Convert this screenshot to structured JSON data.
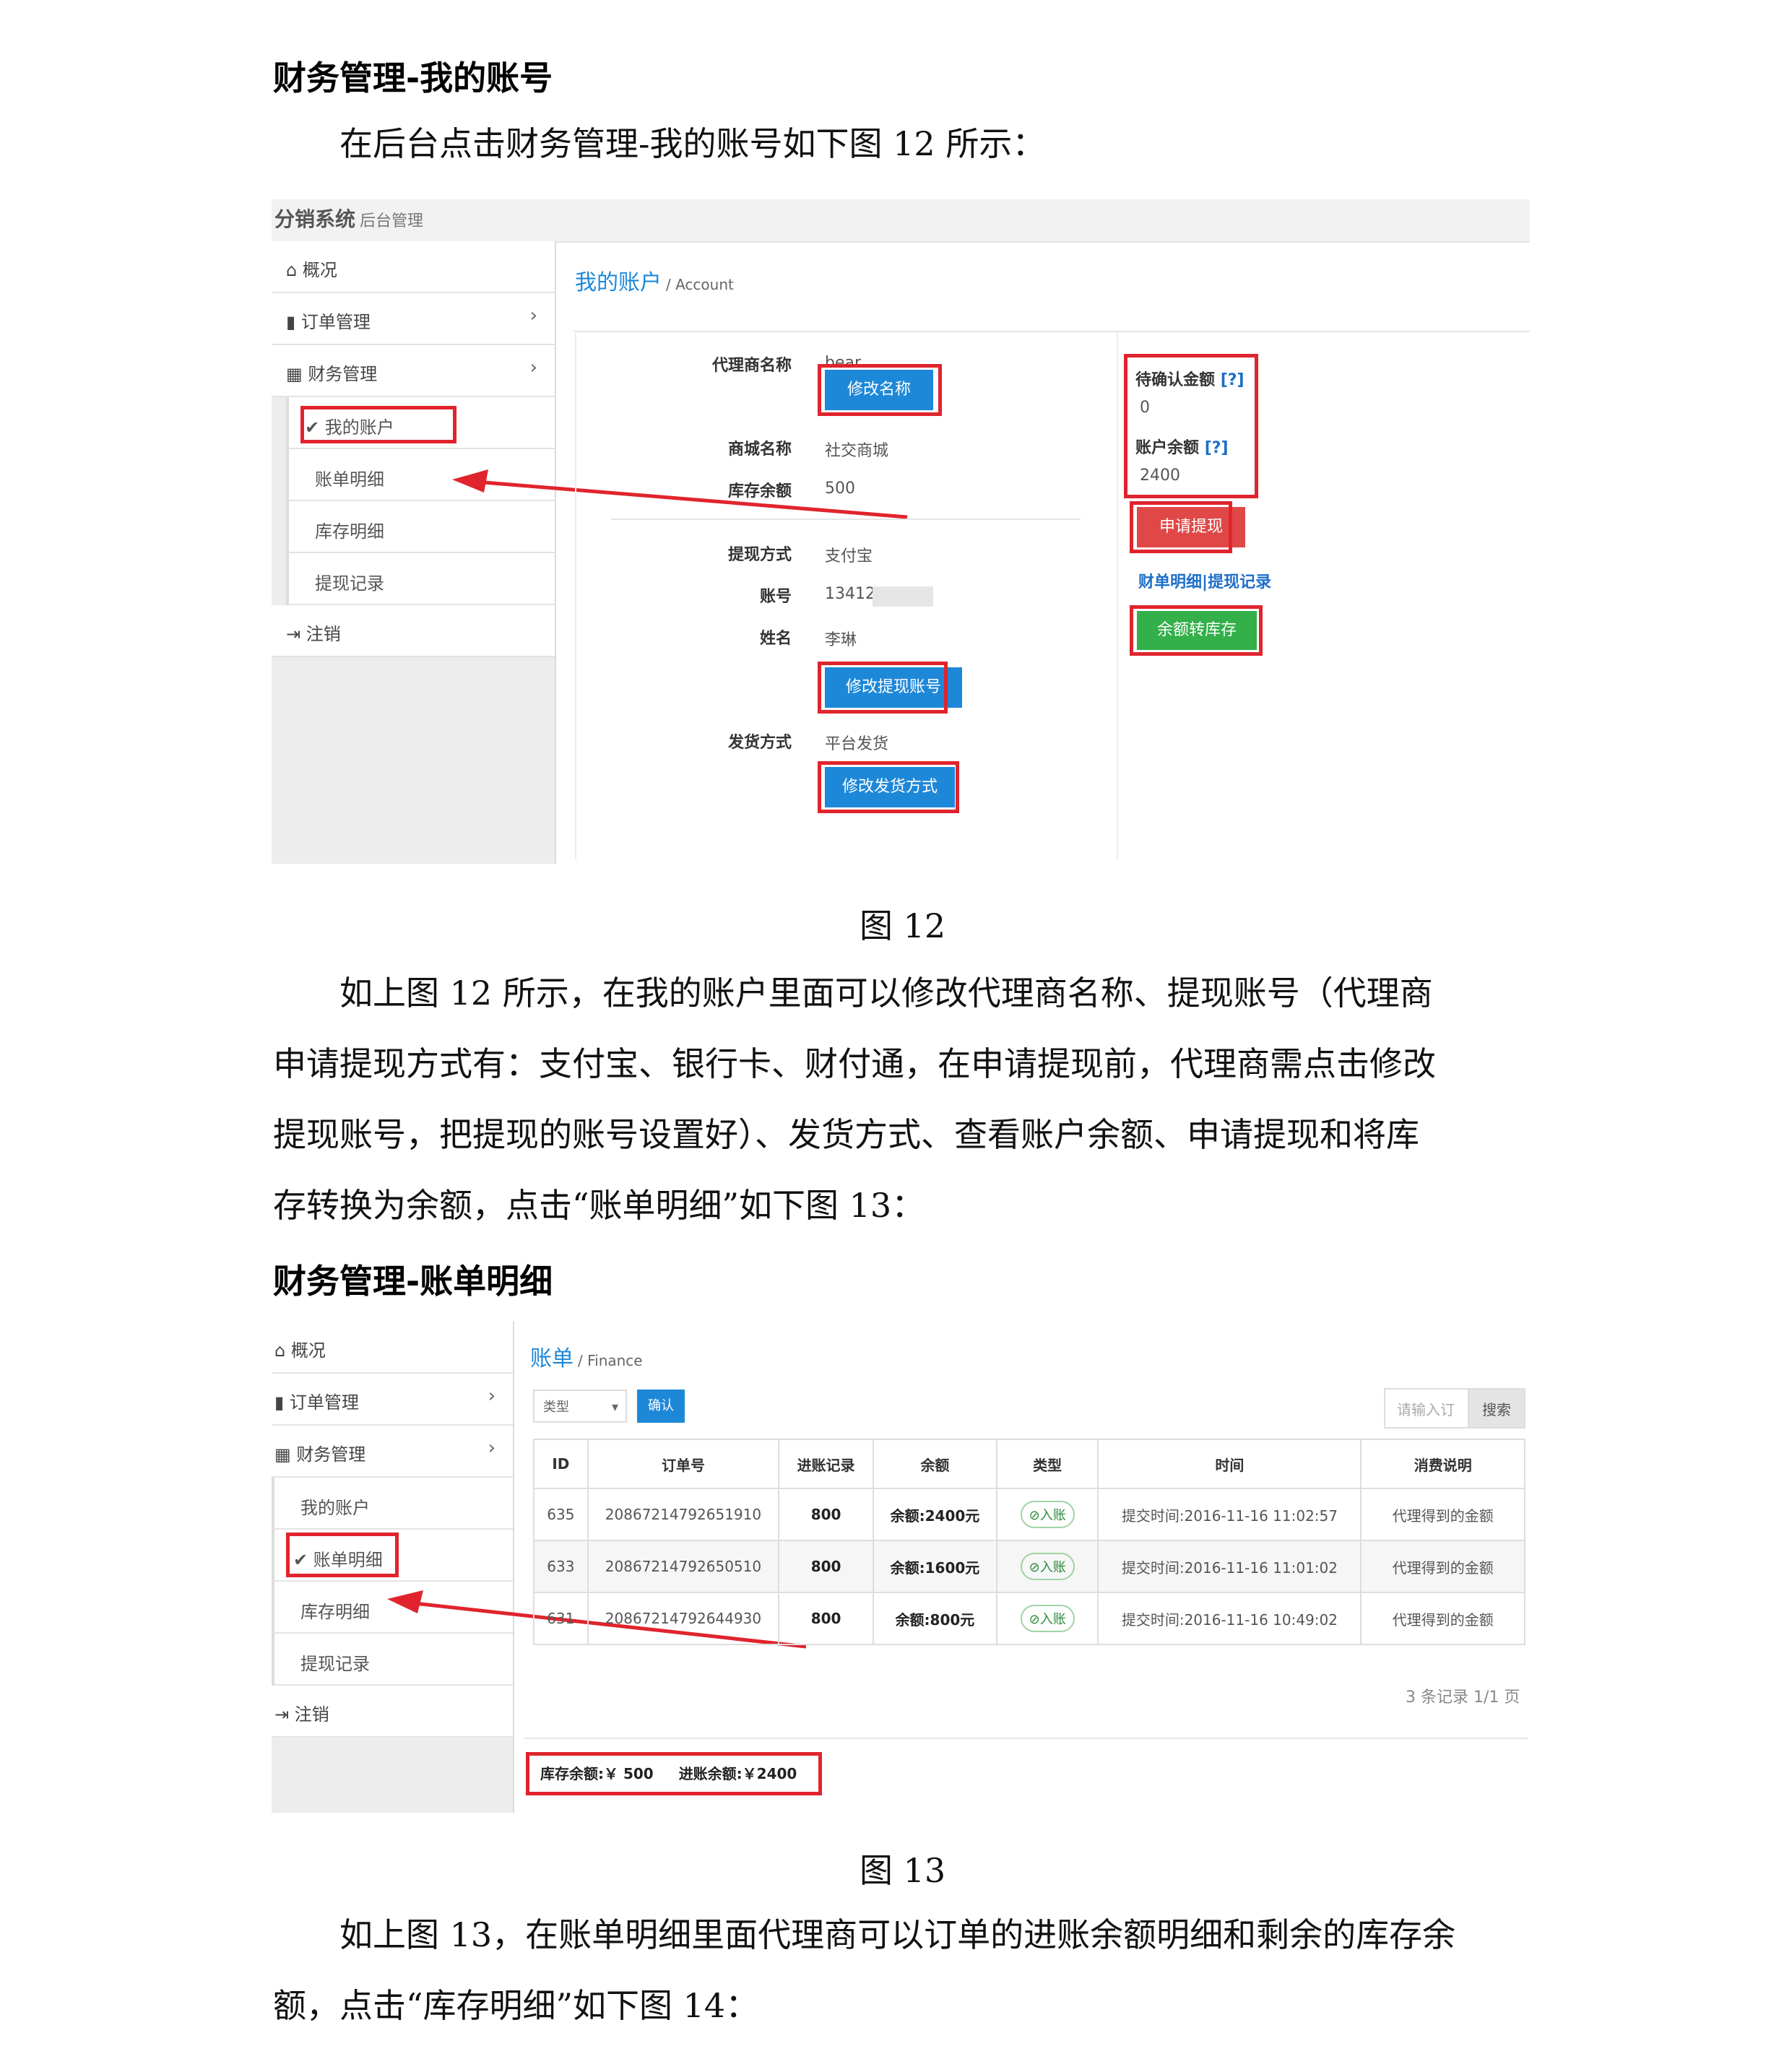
{
  "section1": {
    "heading": "财务管理-我的账号",
    "intro": "在后台点击财务管理-我的账号如下图 12 所示："
  },
  "fig12": {
    "brand": "分销系统",
    "brand_sub": "后台管理",
    "sidebar": {
      "overview": "概况",
      "orders": "订单管理",
      "finance": "财务管理",
      "my_account": "我的账户",
      "bill_detail": "账单明细",
      "stock_detail": "库存明细",
      "withdraw_record": "提现记录",
      "logout": "注销"
    },
    "page_title": "我的账户",
    "page_title_en": "/ Account",
    "fields": {
      "agent_name_label": "代理商名称",
      "agent_name_value": "bear",
      "edit_name_btn": "修改名称",
      "shop_name_label": "商城名称",
      "shop_name_value": "社交商城",
      "stock_balance_label": "库存余额",
      "stock_balance_value": "500",
      "withdraw_method_label": "提现方式",
      "withdraw_method_value": "支付宝",
      "account_label": "账号",
      "account_value": "13412",
      "name_label": "姓名",
      "name_value": "李琳",
      "edit_withdraw_btn": "修改提现账号",
      "ship_method_label": "发货方式",
      "ship_method_value": "平台发货",
      "edit_ship_btn": "修改发货方式"
    },
    "right": {
      "pending_label": "待确认金额",
      "help": "[?]",
      "pending_value": "0",
      "balance_label": "账户余额",
      "balance_value": "2400",
      "apply_withdraw_btn": "申请提现",
      "finance_detail_link": "财单明细",
      "sep": "|",
      "withdraw_record_link": "提现记录",
      "to_stock_btn": "余额转库存"
    },
    "caption": "图 12"
  },
  "paragraph2": "如上图 12 所示，在我的账户里面可以修改代理商名称、提现账号（代理商申请提现方式有：支付宝、银行卡、财付通，在申请提现前，代理商需点击修改提现账号，把提现的账号设置好）、发货方式、查看账户余额、申请提现和将库存转换为余额，点击“账单明细”如下图 13：",
  "paragraph2_lines": [
    "如上图 12 所示，在我的账户里面可以修改代理商名称、提现账号（代理商",
    "申请提现方式有：支付宝、银行卡、财付通，在申请提现前，代理商需点击修改",
    "提现账号，把提现的账号设置好）、发货方式、查看账户余额、申请提现和将库",
    "存转换为余额，点击“账单明细”如下图 13："
  ],
  "section2": {
    "heading": "财务管理-账单明细"
  },
  "fig13": {
    "sidebar": {
      "overview": "概况",
      "orders": "订单管理",
      "finance": "财务管理",
      "my_account": "我的账户",
      "bill_detail": "账单明细",
      "stock_detail": "库存明细",
      "withdraw_record": "提现记录",
      "logout": "注销"
    },
    "page_title": "账单",
    "page_title_en": "/ Finance",
    "type_select": "类型",
    "confirm_btn": "确认",
    "search_placeholder": "请输入订",
    "search_btn": "搜索",
    "columns": [
      "ID",
      "订单号",
      "进账记录",
      "余额",
      "类型",
      "时间",
      "消费说明"
    ],
    "rows": [
      {
        "id": "635",
        "order": "20867214792651910",
        "income": "800",
        "balance": "余额:2400元",
        "type": "入账",
        "time": "提交时间:2016-11-16 11:02:57",
        "desc": "代理得到的金额"
      },
      {
        "id": "633",
        "order": "20867214792650510",
        "income": "800",
        "balance": "余额:1600元",
        "type": "入账",
        "time": "提交时间:2016-11-16 11:01:02",
        "desc": "代理得到的金额"
      },
      {
        "id": "631",
        "order": "20867214792644930",
        "income": "800",
        "balance": "余额:800元",
        "type": "入账",
        "time": "提交时间:2016-11-16 10:49:02",
        "desc": "代理得到的金额"
      }
    ],
    "pager": "3 条记录 1/1 页",
    "footer_stock": "库存余额:￥ 500",
    "footer_income": "进账余额:￥2400",
    "caption": "图 13"
  },
  "paragraph3_lines": [
    "如上图 13，在账单明细里面代理商可以订单的进账余额明细和剩余的库存余",
    "额，点击“库存明细”如下图 14："
  ],
  "colors": {
    "accent": "#1e88d8",
    "highlight": "#e0242d",
    "green": "#33b04a"
  }
}
